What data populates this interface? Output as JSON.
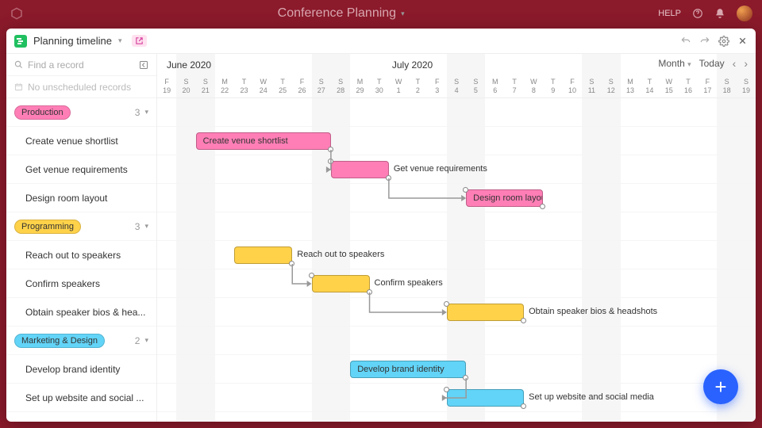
{
  "topbar": {
    "title": "Conference Planning",
    "help": "HELP"
  },
  "panel": {
    "view_name": "Planning timeline",
    "find_placeholder": "Find a record",
    "unscheduled": "No unscheduled records"
  },
  "controls": {
    "scale": "Month",
    "today": "Today"
  },
  "months": {
    "left": "June 2020",
    "right": "July 2020"
  },
  "days": [
    {
      "w": "F",
      "n": "19"
    },
    {
      "w": "S",
      "n": "20"
    },
    {
      "w": "S",
      "n": "21"
    },
    {
      "w": "M",
      "n": "22"
    },
    {
      "w": "T",
      "n": "23"
    },
    {
      "w": "W",
      "n": "24"
    },
    {
      "w": "T",
      "n": "25"
    },
    {
      "w": "F",
      "n": "26"
    },
    {
      "w": "S",
      "n": "27"
    },
    {
      "w": "S",
      "n": "28"
    },
    {
      "w": "M",
      "n": "29"
    },
    {
      "w": "T",
      "n": "30"
    },
    {
      "w": "W",
      "n": "1"
    },
    {
      "w": "T",
      "n": "2"
    },
    {
      "w": "F",
      "n": "3"
    },
    {
      "w": "S",
      "n": "4"
    },
    {
      "w": "S",
      "n": "5"
    },
    {
      "w": "M",
      "n": "6"
    },
    {
      "w": "T",
      "n": "7"
    },
    {
      "w": "W",
      "n": "8"
    },
    {
      "w": "T",
      "n": "9"
    },
    {
      "w": "F",
      "n": "10"
    },
    {
      "w": "S",
      "n": "11"
    },
    {
      "w": "S",
      "n": "12"
    },
    {
      "w": "M",
      "n": "13"
    },
    {
      "w": "T",
      "n": "14"
    },
    {
      "w": "W",
      "n": "15"
    },
    {
      "w": "T",
      "n": "16"
    },
    {
      "w": "F",
      "n": "17"
    },
    {
      "w": "S",
      "n": "18"
    },
    {
      "w": "S",
      "n": "19"
    }
  ],
  "groups": [
    {
      "name": "Production",
      "count": "3",
      "color": "#ff7eb6",
      "tasks": [
        {
          "name": "Create venue shortlist",
          "start": 2,
          "end": 8,
          "label_inside": true
        },
        {
          "name": "Get venue requirements",
          "start": 9,
          "end": 11,
          "label_inside": false
        },
        {
          "name": "Design room layout",
          "start": 16,
          "end": 19,
          "label_inside": true
        }
      ]
    },
    {
      "name": "Programming",
      "count": "3",
      "color": "#ffd24a",
      "tasks": [
        {
          "name": "Reach out to speakers",
          "start": 4,
          "end": 6,
          "label_inside": false
        },
        {
          "name": "Confirm speakers",
          "start": 8,
          "end": 10,
          "label_inside": false
        },
        {
          "name": "Obtain speaker bios & headshots",
          "short": "Obtain speaker bios & hea...",
          "start": 15,
          "end": 18,
          "label_inside": false
        }
      ]
    },
    {
      "name": "Marketing & Design",
      "count": "2",
      "color": "#62d4f7",
      "tasks": [
        {
          "name": "Develop brand identity",
          "start": 10,
          "end": 15,
          "label_inside": true
        },
        {
          "name": "Set up website and social media",
          "short": "Set up website and social ...",
          "start": 15,
          "end": 18,
          "label_inside": false
        }
      ]
    }
  ],
  "colors": {
    "production": "#ff7eb6",
    "programming": "#ffd24a",
    "marketing": "#62d4f7"
  }
}
